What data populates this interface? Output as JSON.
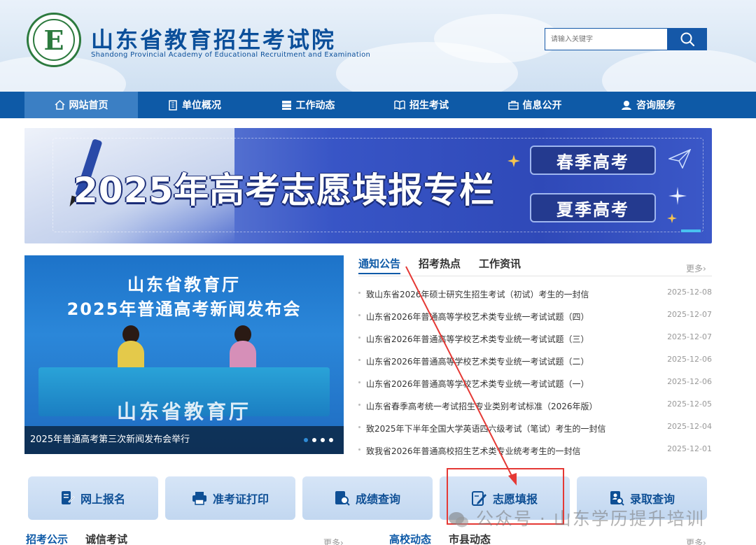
{
  "header": {
    "title": "山东省教育招生考试院",
    "subtitle": "Shandong Provincial Academy of Educational Recruitment and Examination",
    "search_placeholder": "请输入关键字",
    "logo_letter": "E"
  },
  "nav": {
    "items": [
      {
        "label": "网站首页",
        "icon": "home-icon"
      },
      {
        "label": "单位概况",
        "icon": "building-icon"
      },
      {
        "label": "工作动态",
        "icon": "server-icon"
      },
      {
        "label": "招生考试",
        "icon": "book-icon"
      },
      {
        "label": "信息公开",
        "icon": "briefcase-icon"
      },
      {
        "label": "咨询服务",
        "icon": "user-service-icon"
      }
    ]
  },
  "banner": {
    "title": "2025年高考志愿填报专栏",
    "button_spring": "春季高考",
    "button_summer": "夏季高考"
  },
  "feature": {
    "line1": "山东省教育厅",
    "line2": "2025年普通高考新闻发布会",
    "watermark": "山东省教育厅",
    "caption": "2025年普通高考第三次新闻发布会举行"
  },
  "news": {
    "tabs": [
      "通知公告",
      "招考热点",
      "工作资讯"
    ],
    "more": "更多",
    "items": [
      {
        "title": "致山东省2026年硕士研究生招生考试（初试）考生的一封信",
        "date": "2025-12-08"
      },
      {
        "title": "山东省2026年普通高等学校艺术类专业统一考试试题（四）",
        "date": "2025-12-07"
      },
      {
        "title": "山东省2026年普通高等学校艺术类专业统一考试试题（三）",
        "date": "2025-12-07"
      },
      {
        "title": "山东省2026年普通高等学校艺术类专业统一考试试题（二）",
        "date": "2025-12-06"
      },
      {
        "title": "山东省2026年普通高等学校艺术类专业统一考试试题（一）",
        "date": "2025-12-06"
      },
      {
        "title": "山东省春季高考统一考试招生专业类别考试标准（2026年版）",
        "date": "2025-12-05"
      },
      {
        "title": "致2025年下半年全国大学英语四六级考试（笔试）考生的一封信",
        "date": "2025-12-04"
      },
      {
        "title": "致我省2026年普通高校招生艺术类专业统考考生的一封信",
        "date": "2025-12-01"
      }
    ]
  },
  "quick_links": [
    {
      "label": "网上报名",
      "icon": "register-icon"
    },
    {
      "label": "准考证打印",
      "icon": "printer-icon"
    },
    {
      "label": "成绩查询",
      "icon": "score-search-icon"
    },
    {
      "label": "志愿填报",
      "icon": "form-edit-icon"
    },
    {
      "label": "录取查询",
      "icon": "admission-search-icon"
    }
  ],
  "bottom_tabs": {
    "left": [
      "招考公示",
      "诚信考试"
    ],
    "right": [
      "高校动态",
      "市县动态"
    ],
    "more": "更多"
  },
  "watermark": "公众号 · 山东学历提升培训",
  "colors": {
    "primary": "#0e5aa7",
    "highlight": "#e53935",
    "arrow": "#e53935"
  }
}
